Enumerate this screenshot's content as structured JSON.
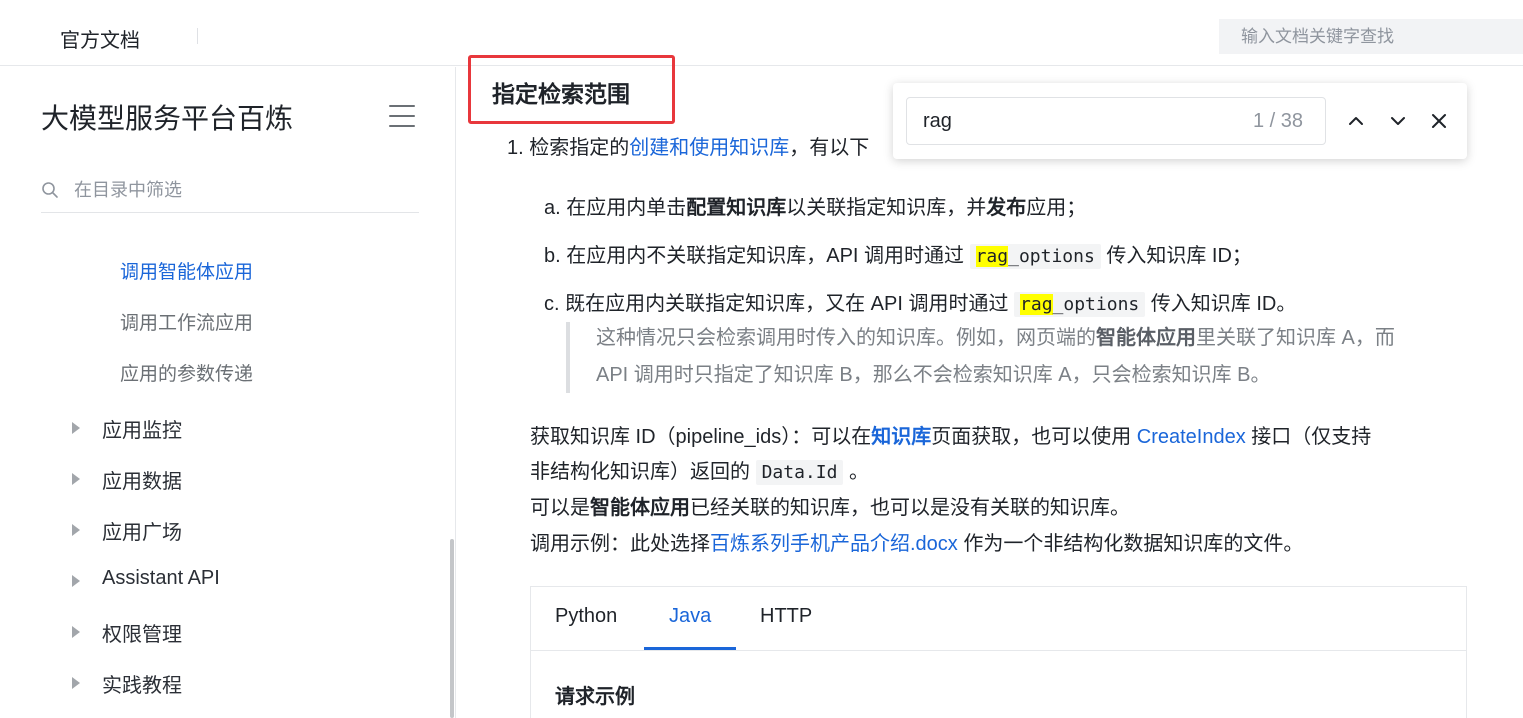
{
  "topbar": {
    "brand": "官方文档",
    "search_placeholder": "输入文档关键字查找"
  },
  "sidebar": {
    "title": "大模型服务平台百炼",
    "filter_placeholder": "在目录中筛选",
    "sub_items": [
      {
        "label": "调用智能体应用",
        "active": true
      },
      {
        "label": "调用工作流应用",
        "active": false
      },
      {
        "label": "应用的参数传递",
        "active": false
      }
    ],
    "groups": [
      {
        "label": "应用监控"
      },
      {
        "label": "应用数据"
      },
      {
        "label": "应用广场"
      },
      {
        "label": "Assistant API"
      },
      {
        "label": "权限管理"
      },
      {
        "label": "实践教程"
      }
    ]
  },
  "main": {
    "section_title": "指定检索范围",
    "item1": {
      "prefix": "1. 检索指定的",
      "link": "创建和使用知识库",
      "suffix": "，有以下"
    },
    "a": {
      "p1": "a. 在应用内单击",
      "b1": "配置知识库",
      "p2": "以关联指定知识库，并",
      "b2": "发布",
      "p3": "应用；"
    },
    "b": {
      "p1": "b. 在应用内不关联指定知识库，API 调用时通过 ",
      "code_hl": "rag",
      "code_rest": "_options",
      "p2": " 传入知识库 ID；"
    },
    "c": {
      "p1": "c. 既在应用内关联指定知识库，又在 API 调用时通过 ",
      "code_hl": "rag",
      "code_rest": "_options",
      "p2": " 传入知识库 ID。"
    },
    "quote": {
      "l1_p1": "这种情况只会检索调用时传入的知识库。例如，网页端的",
      "l1_b": "智能体应用",
      "l1_p2": "里关联了知识库 A，而",
      "l2": "API 调用时只指定了知识库 B，那么不会检索知识库 A，只会检索知识库 B。"
    },
    "get_id": {
      "p1": "获取知识库 ID（pipeline_ids）：可以在",
      "b1": "知识库",
      "p2": "页面获取，也可以使用 ",
      "link": "CreateIndex",
      "p3": " 接口（仅支持",
      "l2_p1": "非结构化知识库）返回的 ",
      "code": "Data.Id",
      "l2_p2": " 。"
    },
    "line_can": {
      "p1": "可以是",
      "b1": "智能体应用",
      "p2": "已经关联的知识库，也可以是没有关联的知识库。"
    },
    "example": {
      "p1": "调用示例：此处选择",
      "link": "百炼系列手机产品介绍.docx",
      "p2": " 作为一个非结构化数据知识库的文件。"
    },
    "tabs": [
      {
        "label": "Python",
        "active": false
      },
      {
        "label": "Java",
        "active": true
      },
      {
        "label": "HTTP",
        "active": false
      }
    ],
    "request_title": "请求示例"
  },
  "findbar": {
    "query": "rag",
    "current": "1",
    "total": "38",
    "count_text": "1  /  38"
  },
  "colors": {
    "accent": "#1a66d9",
    "highlight": "#ffff00",
    "annotation_box": "#e8373c"
  },
  "icons": [
    "search-icon",
    "menu-icon",
    "caret-right-icon",
    "chevron-up-icon",
    "chevron-down-icon",
    "close-icon"
  ]
}
